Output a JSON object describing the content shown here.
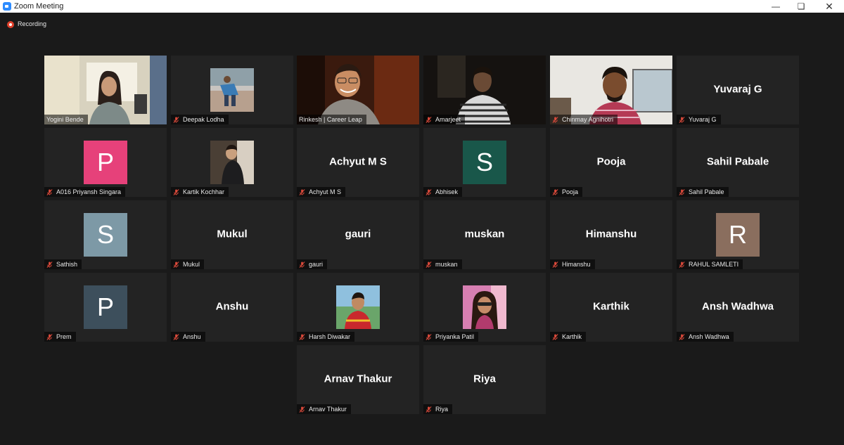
{
  "window": {
    "title": "Zoom Meeting"
  },
  "recording_label": "Recording",
  "tiles": [
    {
      "label": "Yogini Bende"
    },
    {
      "label": "Deepak Lodha"
    },
    {
      "label": "Rinkesh | Career Leap"
    },
    {
      "label": "Amarjeet"
    },
    {
      "label": "Chinmay Agnihotri"
    },
    {
      "label": "Yuvaraj G",
      "display": "Yuvaraj G"
    },
    {
      "label": "A016 Priyansh Singara",
      "avatar": "P",
      "avatar_color": "#e6417a"
    },
    {
      "label": "Kartik Kochhar"
    },
    {
      "label": "Achyut M S",
      "display": "Achyut M S"
    },
    {
      "label": "Abhisek",
      "avatar": "S",
      "avatar_color": "#19574a"
    },
    {
      "label": "Pooja",
      "display": "Pooja"
    },
    {
      "label": "Sahil Pabale",
      "display": "Sahil Pabale"
    },
    {
      "label": "Sathish",
      "avatar": "S",
      "avatar_color": "#7d99a6"
    },
    {
      "label": "Mukul",
      "display": "Mukul"
    },
    {
      "label": "gauri",
      "display": "gauri"
    },
    {
      "label": "muskan",
      "display": "muskan"
    },
    {
      "label": "Himanshu",
      "display": "Himanshu"
    },
    {
      "label": "RAHUL SAMLETI",
      "avatar": "R",
      "avatar_color": "#8a6e5e"
    },
    {
      "label": "Prem",
      "avatar": "P",
      "avatar_color": "#3d4f5c"
    },
    {
      "label": "Anshu",
      "display": "Anshu"
    },
    {
      "label": "Harsh Diwakar"
    },
    {
      "label": "Priyanka Patil"
    },
    {
      "label": "Karthik",
      "display": "Karthik"
    },
    {
      "label": "Ansh Wadhwa",
      "display": "Ansh Wadhwa"
    },
    {
      "label": "Arnav Thakur",
      "display": "Arnav Thakur"
    },
    {
      "label": "Riya",
      "display": "Riya"
    }
  ]
}
